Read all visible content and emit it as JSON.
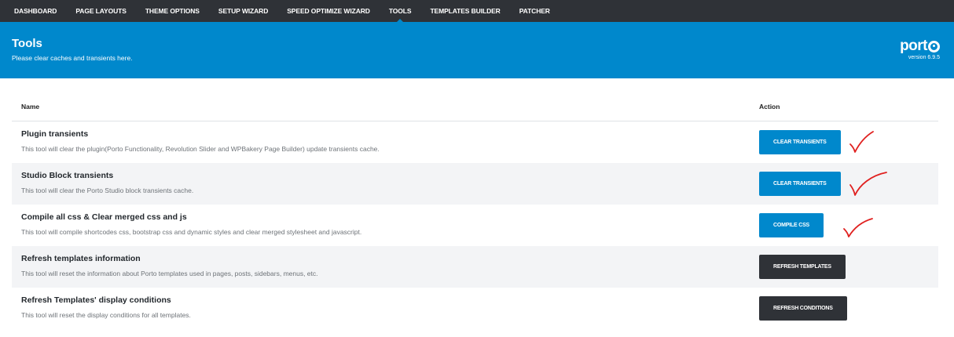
{
  "nav": {
    "items": [
      {
        "label": "DASHBOARD",
        "active": false
      },
      {
        "label": "PAGE LAYOUTS",
        "active": false
      },
      {
        "label": "THEME OPTIONS",
        "active": false
      },
      {
        "label": "SETUP WIZARD",
        "active": false
      },
      {
        "label": "SPEED OPTIMIZE WIZARD",
        "active": false
      },
      {
        "label": "TOOLS",
        "active": true
      },
      {
        "label": "TEMPLATES BUILDER",
        "active": false
      },
      {
        "label": "PATCHER",
        "active": false
      }
    ]
  },
  "header": {
    "title": "Tools",
    "subtitle": "Please clear caches and transients here.",
    "logo_text": "port",
    "version": "version 6.9.5"
  },
  "table": {
    "columns": {
      "name": "Name",
      "action": "Action"
    },
    "rows": [
      {
        "title": "Plugin transients",
        "description": "This tool will clear the plugin(Porto Functionality, Revolution Slider and WPBakery Page Builder) update transients cache.",
        "button": "CLEAR TRANSIENTS",
        "style": "primary"
      },
      {
        "title": "Studio Block transients",
        "description": "This tool will clear the Porto Studio block transients cache.",
        "button": "CLEAR TRANSIENTS",
        "style": "primary"
      },
      {
        "title": "Compile all css & Clear merged css and js",
        "description": "This tool will compile shortcodes css, bootstrap css and dynamic styles and clear merged stylesheet and javascript.",
        "button": "COMPILE CSS",
        "style": "primary"
      },
      {
        "title": "Refresh templates information",
        "description": "This tool will reset the information about Porto templates used in pages, posts, sidebars, menus, etc.",
        "button": "REFRESH TEMPLATES",
        "style": "dark"
      },
      {
        "title": "Refresh Templates' display conditions",
        "description": "This tool will reset the display conditions for all templates.",
        "button": "REFRESH CONDITIONS",
        "style": "dark"
      }
    ]
  },
  "colors": {
    "nav_bg": "#2f3237",
    "brand_blue": "#0088cc",
    "dark_button": "#2f3237",
    "checkmark": "#e0201f"
  }
}
